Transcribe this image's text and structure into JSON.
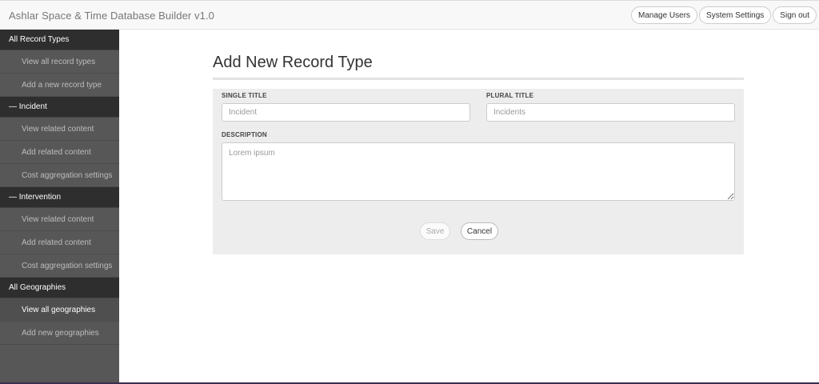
{
  "header": {
    "brand": "Ashlar Space & Time Database Builder v1.0",
    "buttons": [
      "Manage Users",
      "System Settings",
      "Sign out"
    ]
  },
  "sidebar": {
    "sections": [
      {
        "title": "All Record Types",
        "items": [
          {
            "label": "View all record types",
            "active": false
          },
          {
            "label": "Add a new record type",
            "active": false
          }
        ]
      },
      {
        "title": "— Incident",
        "items": [
          {
            "label": "View related content",
            "active": false
          },
          {
            "label": "Add related content",
            "active": false
          },
          {
            "label": "Cost aggregation settings",
            "active": false
          }
        ]
      },
      {
        "title": "— Intervention",
        "items": [
          {
            "label": "View related content",
            "active": false
          },
          {
            "label": "Add related content",
            "active": false
          },
          {
            "label": "Cost aggregation settings",
            "active": false
          }
        ]
      },
      {
        "title": "All Geographies",
        "items": [
          {
            "label": "View all geographies",
            "active": true
          },
          {
            "label": "Add new geographies",
            "active": false
          }
        ]
      }
    ]
  },
  "main": {
    "page_title": "Add New Record Type",
    "form": {
      "single_title_label": "SINGLE TITLE",
      "single_title_placeholder": "Incident",
      "plural_title_label": "PLURAL TITLE",
      "plural_title_placeholder": "Incidents",
      "description_label": "DESCRIPTION",
      "description_placeholder": "Lorem ipsum",
      "save_label": "Save",
      "cancel_label": "Cancel"
    }
  }
}
